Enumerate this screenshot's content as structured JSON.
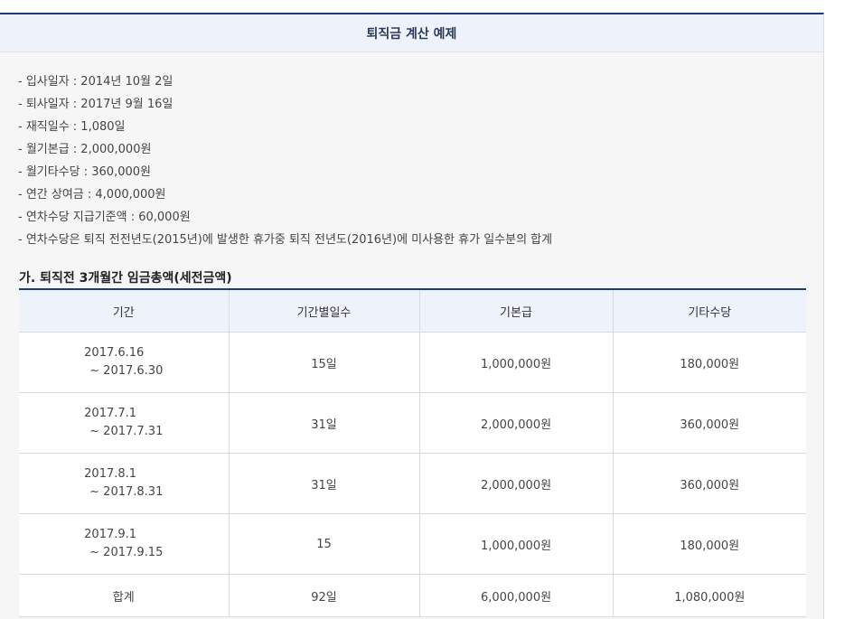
{
  "title": "퇴직금 계산 예제",
  "info_items": [
    "- 입사일자 : 2014년 10월 2일",
    "- 퇴사일자 : 2017년 9월 16일",
    "- 재직일수 : 1,080일",
    "- 월기본급 : 2,000,000원",
    "- 월기타수당 : 360,000원",
    "- 연간 상여금 : 4,000,000원",
    "- 연차수당 지급기준액 : 60,000원",
    "- 연차수당은 퇴직 전전년도(2015년)에 발생한 휴가중 퇴직 전년도(2016년)에 미사용한 휴가 일수분의 합계"
  ],
  "section_title": "가. 퇴직전 3개월간 임금총액(세전금액)",
  "table": {
    "headers": [
      "기간",
      "기간별일수",
      "기본급",
      "기타수당"
    ],
    "rows": [
      {
        "period_start": "2017.6.16",
        "period_end": "~ 2017.6.30",
        "days": "15일",
        "base": "1,000,000원",
        "other": "180,000원"
      },
      {
        "period_start": "2017.7.1",
        "period_end": "~ 2017.7.31",
        "days": "31일",
        "base": "2,000,000원",
        "other": "360,000원"
      },
      {
        "period_start": "2017.8.1",
        "period_end": "~ 2017.8.31",
        "days": "31일",
        "base": "2,000,000원",
        "other": "360,000원"
      },
      {
        "period_start": "2017.9.1",
        "period_end": "~ 2017.9.15",
        "days": "15",
        "base": "1,000,000원",
        "other": "180,000원"
      }
    ],
    "total": {
      "label": "합계",
      "days": "92일",
      "base": "6,000,000원",
      "other": "1,080,000원"
    }
  }
}
